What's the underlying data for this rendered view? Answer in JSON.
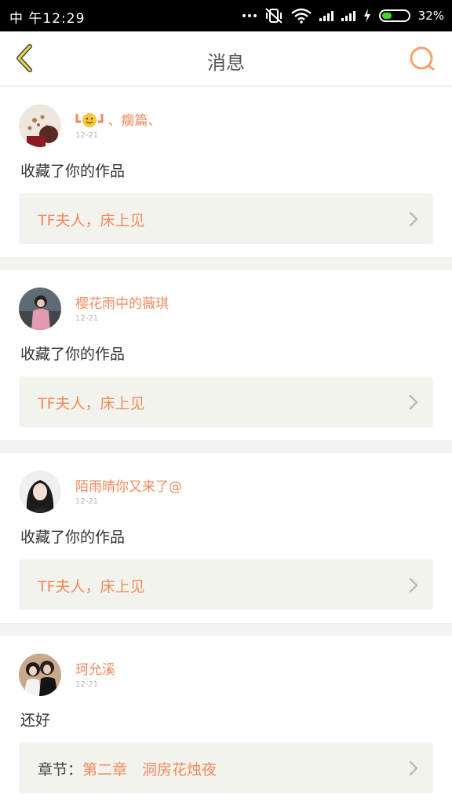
{
  "status_bar": {
    "left_text": "中 午12:29",
    "battery": "32%"
  },
  "nav": {
    "title": "消息"
  },
  "items": [
    {
      "name": "、瘸篇、",
      "date": "12-21",
      "action": "收藏了你的作品",
      "work": "TF夫人，床上见"
    },
    {
      "name": "樱花雨中的薇琪",
      "date": "12-21",
      "action": "收藏了你的作品",
      "work": "TF夫人，床上见"
    },
    {
      "name": "陌雨晴你又来了@",
      "date": "12-21",
      "action": "收藏了你的作品",
      "work": "TF夫人，床上见"
    },
    {
      "name": "珂允溪",
      "date": "12-21",
      "action": "还好",
      "work_prefix": "章节：",
      "work": "第二章　洞房花烛夜"
    }
  ]
}
